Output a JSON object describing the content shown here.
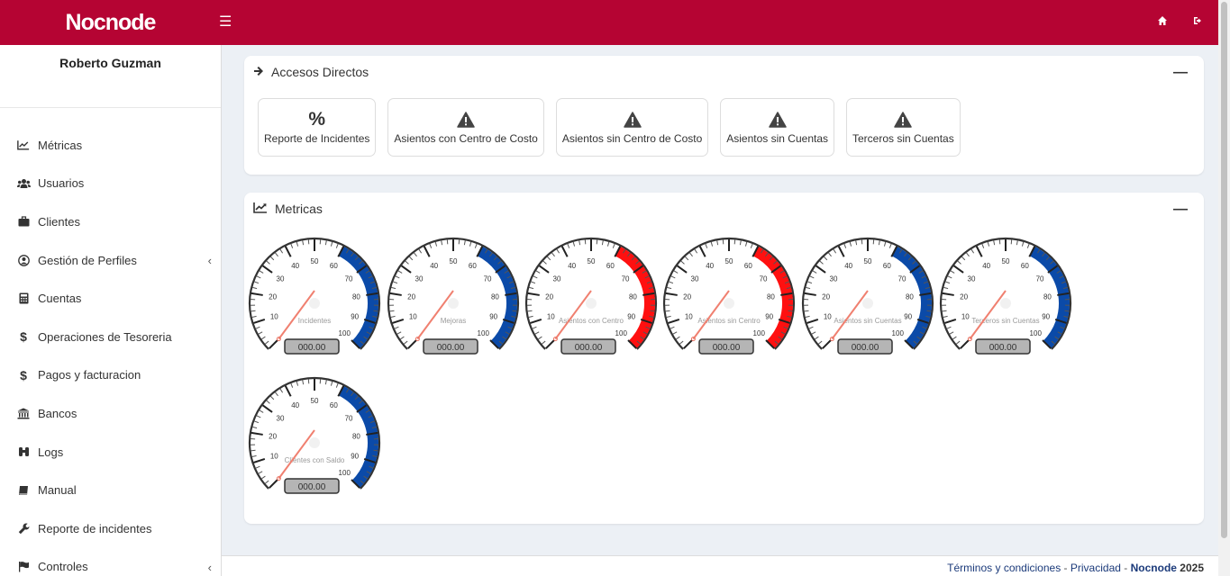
{
  "app": {
    "brand": "Nocnode"
  },
  "user": {
    "name": "Roberto Guzman"
  },
  "sidebar": {
    "items": [
      {
        "label": "Métricas",
        "icon": "chart-line-icon",
        "submenu": false
      },
      {
        "label": "Usuarios",
        "icon": "users-icon",
        "submenu": false
      },
      {
        "label": "Clientes",
        "icon": "briefcase-icon",
        "submenu": false
      },
      {
        "label": "Gestión de Perfiles",
        "icon": "user-circle-icon",
        "submenu": true
      },
      {
        "label": "Cuentas",
        "icon": "calculator-icon",
        "submenu": false
      },
      {
        "label": "Operaciones de Tesoreria",
        "icon": "dollar-icon",
        "submenu": false
      },
      {
        "label": "Pagos y facturacion",
        "icon": "dollar-icon",
        "submenu": false
      },
      {
        "label": "Bancos",
        "icon": "bank-icon",
        "submenu": false
      },
      {
        "label": "Logs",
        "icon": "binoculars-icon",
        "submenu": false
      },
      {
        "label": "Manual",
        "icon": "book-icon",
        "submenu": false
      },
      {
        "label": "Reporte de incidentes",
        "icon": "wrench-icon",
        "submenu": false
      },
      {
        "label": "Controles",
        "icon": "flag-icon",
        "submenu": true
      }
    ]
  },
  "shortcuts": {
    "title": "Accesos Directos",
    "items": [
      {
        "label": "Reporte de Incidentes",
        "icon": "percent-icon"
      },
      {
        "label": "Asientos con Centro de Costo",
        "icon": "warning-icon"
      },
      {
        "label": "Asientos sin Centro de Costo",
        "icon": "warning-icon"
      },
      {
        "label": "Asientos sin Cuentas",
        "icon": "warning-icon"
      },
      {
        "label": "Terceros sin Cuentas",
        "icon": "warning-icon"
      }
    ]
  },
  "metrics": {
    "title": "Metricas",
    "scale": [
      10,
      20,
      30,
      40,
      50,
      60,
      70,
      80,
      90,
      100
    ],
    "value": 0,
    "gauges": [
      {
        "label": "Incidentes",
        "readout": "000.00",
        "band_color": "#0b4aa8"
      },
      {
        "label": "Mejoras",
        "readout": "000.00",
        "band_color": "#0b4aa8"
      },
      {
        "label": "Asientos con Centro",
        "readout": "000.00",
        "band_color": "#ff1010"
      },
      {
        "label": "Asientos sin Centro",
        "readout": "000.00",
        "band_color": "#ff1010"
      },
      {
        "label": "Asientos sin Cuentas",
        "readout": "000.00",
        "band_color": "#0b4aa8"
      },
      {
        "label": "Terceros sin Cuentas",
        "readout": "000.00",
        "band_color": "#0b4aa8"
      },
      {
        "label": "Clientes con Saldo",
        "readout": "000.00",
        "band_color": "#0b4aa8"
      }
    ]
  },
  "footer": {
    "terms": "Términos y condiciones",
    "sep": "-",
    "privacy": "Privacidad",
    "company": "Nocnode",
    "year": "2025"
  },
  "colors": {
    "primary": "#b50433",
    "link": "#1b3a7a"
  }
}
